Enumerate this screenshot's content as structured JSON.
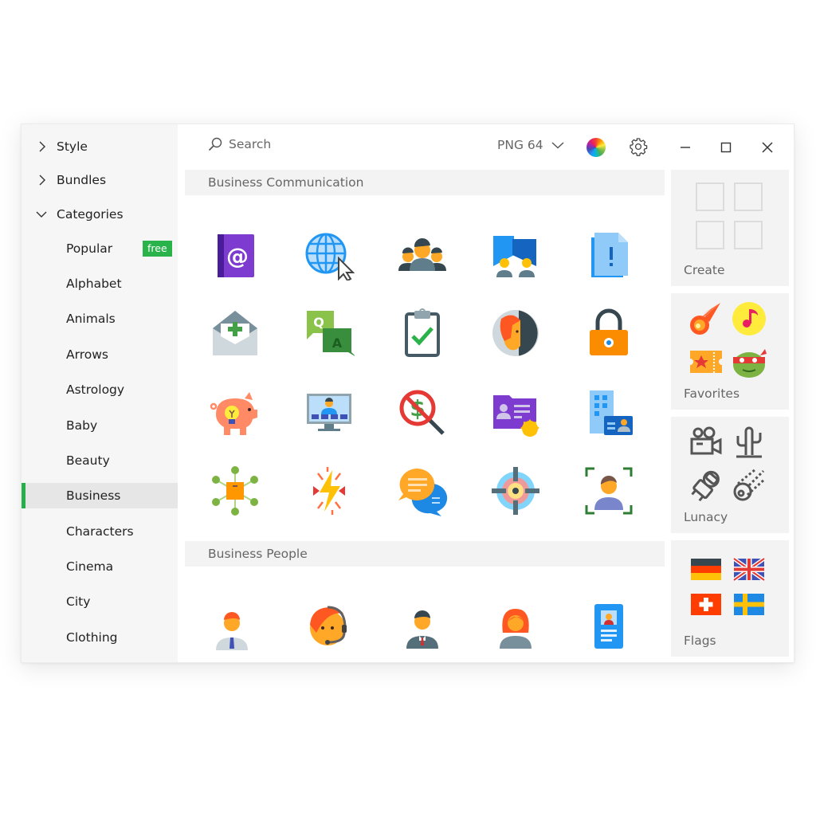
{
  "sidebar": {
    "top_items": [
      {
        "label": "Style",
        "expanded": false
      },
      {
        "label": "Bundles",
        "expanded": false
      },
      {
        "label": "Categories",
        "expanded": true
      }
    ],
    "categories": [
      {
        "label": "Popular",
        "badge": "free"
      },
      {
        "label": "Alphabet"
      },
      {
        "label": "Animals"
      },
      {
        "label": "Arrows"
      },
      {
        "label": "Astrology"
      },
      {
        "label": "Baby"
      },
      {
        "label": "Beauty"
      },
      {
        "label": "Business",
        "active": true
      },
      {
        "label": "Characters"
      },
      {
        "label": "Cinema"
      },
      {
        "label": "City"
      },
      {
        "label": "Clothing"
      }
    ],
    "accent_color": "#2ab24b"
  },
  "toolbar": {
    "search_placeholder": "Search",
    "format_selected": "PNG 64",
    "icons": [
      "search-icon",
      "chevron-down-icon",
      "color-wheel-icon",
      "gear-icon",
      "minimize-icon",
      "maximize-icon",
      "close-icon"
    ]
  },
  "main": {
    "sections": [
      {
        "title": "Business Communication",
        "icons": [
          "address-book-icon",
          "globe-cursor-icon",
          "group-icon",
          "communication-icon",
          "document-alert-icon",
          "envelope-add-icon",
          "qa-icon",
          "clipboard-check-icon",
          "profile-door-icon",
          "lock-icon",
          "piggy-bank-idea-icon",
          "video-conference-icon",
          "no-money-search-icon",
          "business-card-folder-icon",
          "company-id-icon",
          "network-box-icon",
          "conflict-icon",
          "chat-bubbles-icon",
          "target-icon",
          "face-scan-icon"
        ]
      },
      {
        "title": "Business People",
        "icons": [
          "businessman-icon",
          "support-agent-icon",
          "manager-icon",
          "businesswoman-icon",
          "id-card-icon"
        ]
      }
    ]
  },
  "right_panel": {
    "cards": [
      {
        "label": "Create",
        "icons": [
          "placeholder",
          "placeholder",
          "placeholder",
          "placeholder"
        ]
      },
      {
        "label": "Favorites",
        "icons": [
          "comet-icon",
          "music-note-icon",
          "ticket-icon",
          "ninja-turtle-icon"
        ]
      },
      {
        "label": "Lunacy",
        "icons": [
          "movie-camera-icon",
          "cactus-icon",
          "astronaut-icon",
          "meteor-icon"
        ]
      },
      {
        "label": "Flags",
        "icons": [
          "germany-flag-icon",
          "uk-flag-icon",
          "switzerland-flag-icon",
          "sweden-flag-icon"
        ]
      }
    ]
  }
}
